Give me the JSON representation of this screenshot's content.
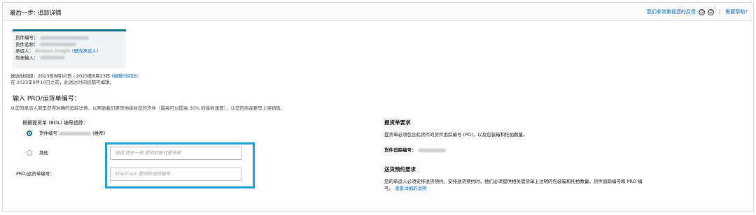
{
  "header": {
    "title": "最后一步: 追踪详情",
    "feedback": "我们非常重视您的反馈",
    "help": "需要帮助?"
  },
  "card": {
    "shipment_id_label": "货件编号：",
    "shipment_name_label": "货件名称：",
    "carrier_label": "承运人：",
    "carrier_value": "Amazon Freight",
    "change_carrier": "(更改承运人)",
    "incomplete_label": "尚未输入："
  },
  "delivery": {
    "window_label": "送达时间段：",
    "window_value": "2023年8月10日 - 2023年8月23日",
    "edit_link": "(编辑时间段)",
    "note": "在 2023年8月10日之前，此送达时间段都可编辑。"
  },
  "section": {
    "title": "输入 PRO/运货单编号：",
    "description": "从您的承运人那里获得准确的追踪详情，以帮助我们更快地接收您的货件（最高可以提高 30% 的接收速度），让您的商品更早上架销售。",
    "sub_title": "根据提货单 (BOL) 编号追踪："
  },
  "options": [
    {
      "label": "货件编号",
      "suffix": "(推荐)",
      "selected": true
    },
    {
      "label": "其他",
      "selected": false
    }
  ],
  "inputs": {
    "other_placeholder": "描述'货件一览'提供的替代提货单",
    "pro_label": "PRO/运货单编号：",
    "pro_placeholder": "ShipTrack 提供的追踪编号"
  },
  "right": {
    "bol_title": "提货单要求",
    "bol_text": "提货单必须包含此货件的货件追踪编号 (PO)，以及包装箱和托拍数量。",
    "tracking_label": "货件追踪编号：",
    "appt_title": "送货预约要求",
    "appt_text_1": "您的承运人必须安排送货预约。安排送货预约时，他们必须提供相关提货单上注明的包装箱和托拍数量，货件追踪编号和 PRO 编",
    "appt_text_2": "号。",
    "appt_link": "查看详细的说明"
  }
}
